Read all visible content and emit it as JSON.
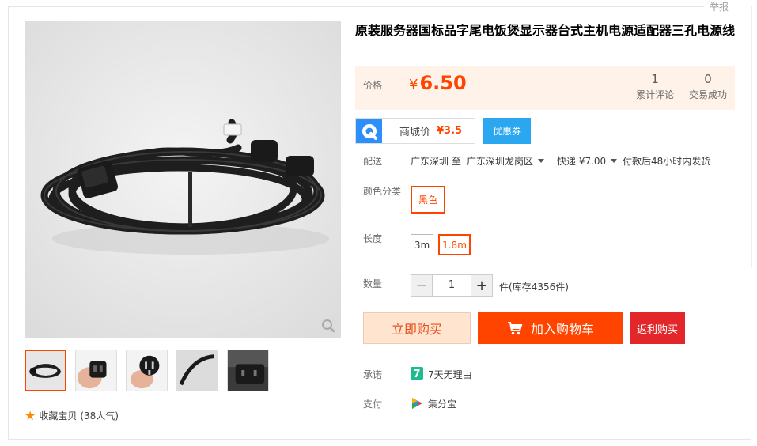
{
  "report_link": "举报",
  "gallery": {
    "thumb_count": 5,
    "collect_label": "收藏宝贝",
    "collect_count": "(38人气)"
  },
  "product": {
    "title": "原装服务器国标品字尾电饭煲显示器台式主机电源适配器三孔电源线"
  },
  "price": {
    "label": "价格",
    "currency": "¥",
    "value": "6.50",
    "reviews_count": "1",
    "reviews_label": "累计评论",
    "deals_count": "0",
    "deals_label": "交易成功"
  },
  "mall": {
    "label": "商城价",
    "price": "¥3.5",
    "coupon_button": "优惠券"
  },
  "delivery": {
    "label": "配送",
    "from": "广东深圳 至",
    "to": "广东深圳龙岗区",
    "shipping": "快递 ¥7.00",
    "ship_time": "付款后48小时内发货"
  },
  "sku": {
    "color_label": "颜色分类",
    "color_option": "黑色",
    "length_label": "长度",
    "length_options": [
      "3m",
      "1.8m"
    ],
    "selected_length": "1.8m"
  },
  "quantity": {
    "label": "数量",
    "value": "1",
    "minus": "−",
    "plus": "+",
    "stock": "件(库存4356件)"
  },
  "actions": {
    "buy_now": "立即购买",
    "add_to_cart": "加入购物车",
    "rebate": "返利购买"
  },
  "promise": {
    "label": "承诺",
    "icon_text": "7",
    "text": "7天无理由"
  },
  "payment": {
    "label": "支付",
    "text": "集分宝"
  },
  "colors": {
    "accent": "#ff4400",
    "price_bg": "#fff2e8",
    "coupon_blue": "#2ba7f0",
    "rebate_red": "#e3262a"
  }
}
